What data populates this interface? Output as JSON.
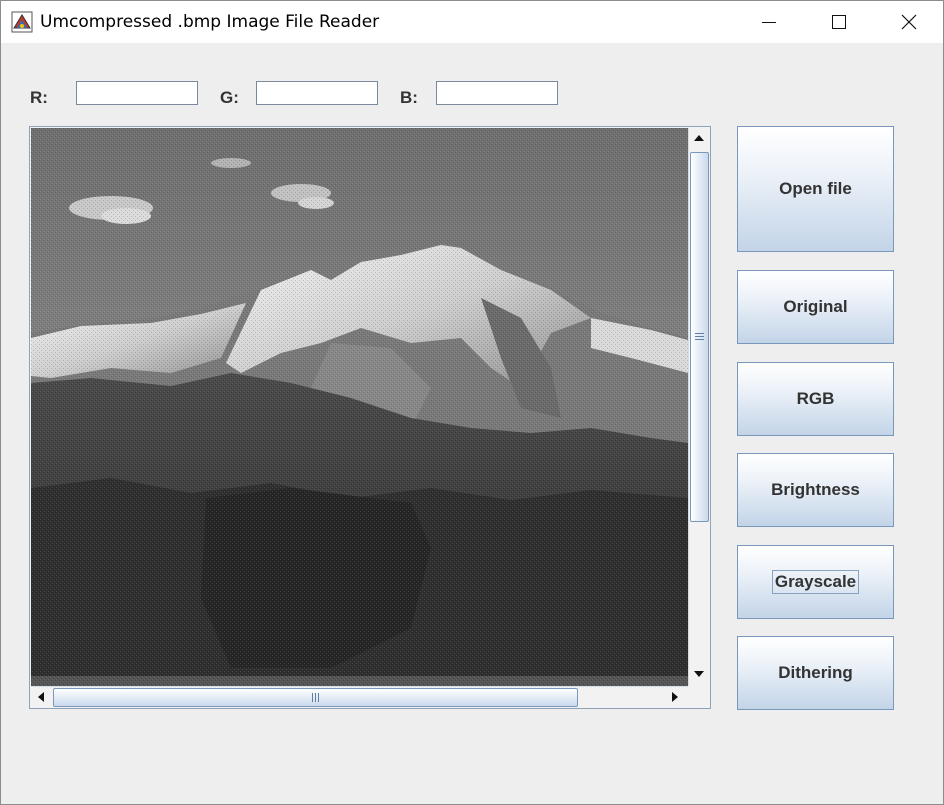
{
  "window": {
    "title": "Umcompressed .bmp Image File Reader",
    "minimize_icon": "minimize-icon",
    "maximize_icon": "maximize-icon",
    "close_icon": "close-icon"
  },
  "rgb_panel": {
    "r_label": "R:",
    "g_label": "G:",
    "b_label": "B:",
    "r_value": "",
    "g_value": "",
    "b_value": ""
  },
  "buttons": {
    "open_file": "Open file",
    "original": "Original",
    "rgb": "RGB",
    "brightness": "Brightness",
    "grayscale": "Grayscale",
    "dithering": "Dithering"
  },
  "image_view": {
    "content": "grayscale dithered mountain landscape",
    "vertical_scroll_icon_up": "arrow-up-icon",
    "vertical_scroll_icon_down": "arrow-down-icon",
    "horizontal_scroll_icon_left": "arrow-left-icon",
    "horizontal_scroll_icon_right": "arrow-right-icon"
  },
  "colors": {
    "window_bg": "#eeeeee",
    "button_border": "#7a98bc",
    "button_gradient_bottom": "#c3d4e8"
  }
}
